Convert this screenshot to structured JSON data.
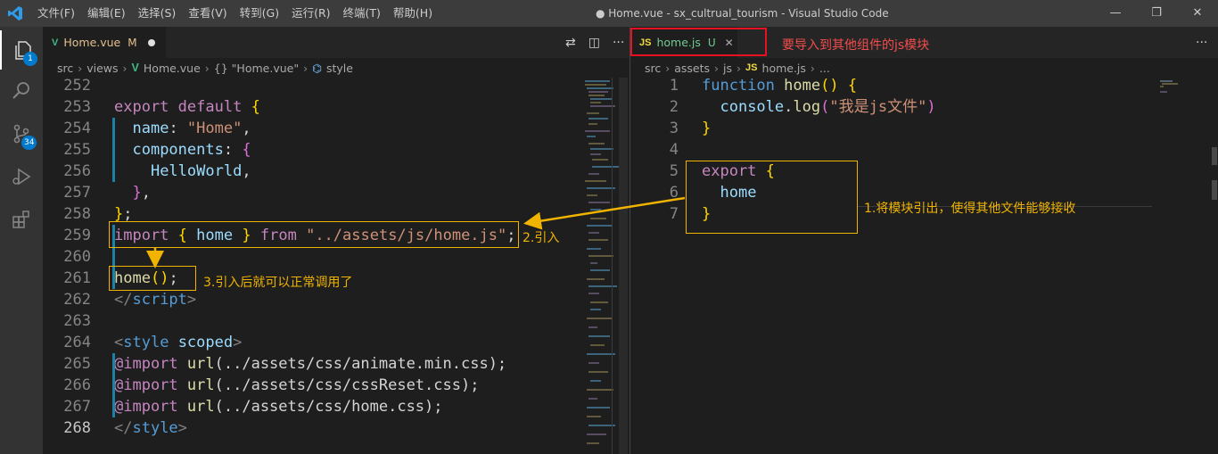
{
  "menu": [
    "文件(F)",
    "编辑(E)",
    "选择(S)",
    "查看(V)",
    "转到(G)",
    "运行(R)",
    "终端(T)",
    "帮助(H)"
  ],
  "window_title": "● Home.vue - sx_cultrual_tourism - Visual Studio Code",
  "window_controls": {
    "minimize": "—",
    "restore": "❐",
    "close": "✕"
  },
  "activity": {
    "explorer_badge": "1",
    "scm_badge": "34"
  },
  "left": {
    "tab": {
      "icon": "V",
      "name": "Home.vue",
      "status": "M"
    },
    "breadcrumbs": [
      "src",
      "views",
      "Home.vue",
      "{} \"Home.vue\"",
      "style"
    ],
    "lines": [
      {
        "n": "252",
        "tokens": []
      },
      {
        "n": "253",
        "tokens": [
          [
            "kw",
            "export"
          ],
          [
            "pc",
            " "
          ],
          [
            "kw",
            "default"
          ],
          [
            "pc",
            " "
          ],
          [
            "br1",
            "{"
          ]
        ]
      },
      {
        "n": "254",
        "tokens": [
          [
            "pc",
            "  "
          ],
          [
            "pr",
            "name"
          ],
          [
            "pc",
            ": "
          ],
          [
            "st",
            "\"Home\""
          ],
          [
            "pc",
            ","
          ]
        ]
      },
      {
        "n": "255",
        "tokens": [
          [
            "pc",
            "  "
          ],
          [
            "pr",
            "components"
          ],
          [
            "pc",
            ": "
          ],
          [
            "br2",
            "{"
          ]
        ]
      },
      {
        "n": "256",
        "tokens": [
          [
            "pc",
            "    "
          ],
          [
            "vr",
            "HelloWorld"
          ],
          [
            "pc",
            ","
          ]
        ]
      },
      {
        "n": "257",
        "tokens": [
          [
            "pc",
            "  "
          ],
          [
            "br2",
            "}"
          ],
          [
            "pc",
            ","
          ]
        ]
      },
      {
        "n": "258",
        "tokens": [
          [
            "br1",
            "}"
          ],
          [
            "pc",
            ";"
          ]
        ]
      },
      {
        "n": "259",
        "tokens": [
          [
            "kw",
            "import"
          ],
          [
            "pc",
            " "
          ],
          [
            "br1",
            "{"
          ],
          [
            "pc",
            " "
          ],
          [
            "vr",
            "home"
          ],
          [
            "pc",
            " "
          ],
          [
            "br1",
            "}"
          ],
          [
            "pc",
            " "
          ],
          [
            "kw",
            "from"
          ],
          [
            "pc",
            " "
          ],
          [
            "st",
            "\"../assets/js/home.js\""
          ],
          [
            "pc",
            ";"
          ]
        ]
      },
      {
        "n": "260",
        "tokens": []
      },
      {
        "n": "261",
        "tokens": [
          [
            "fn",
            "home"
          ],
          [
            "br1",
            "()"
          ],
          [
            "pc",
            ";"
          ]
        ]
      },
      {
        "n": "262",
        "tokens": [
          [
            "tag",
            "</"
          ],
          [
            "tg",
            "script"
          ],
          [
            "tag",
            ">"
          ]
        ]
      },
      {
        "n": "263",
        "tokens": []
      },
      {
        "n": "264",
        "tokens": [
          [
            "tag",
            "<"
          ],
          [
            "tg",
            "style"
          ],
          [
            "pc",
            " "
          ],
          [
            "at",
            "scoped"
          ],
          [
            "tag",
            ">"
          ]
        ]
      },
      {
        "n": "265",
        "tokens": [
          [
            "kw",
            "@import"
          ],
          [
            "pc",
            " "
          ],
          [
            "fn",
            "url"
          ],
          [
            "pc",
            "("
          ],
          [
            "ur",
            "../assets/css/animate.min.css"
          ],
          [
            "pc",
            ");"
          ]
        ]
      },
      {
        "n": "266",
        "tokens": [
          [
            "kw",
            "@import"
          ],
          [
            "pc",
            " "
          ],
          [
            "fn",
            "url"
          ],
          [
            "pc",
            "("
          ],
          [
            "ur",
            "../assets/css/cssReset.css"
          ],
          [
            "pc",
            ");"
          ]
        ]
      },
      {
        "n": "267",
        "tokens": [
          [
            "kw",
            "@import"
          ],
          [
            "pc",
            " "
          ],
          [
            "fn",
            "url"
          ],
          [
            "pc",
            "("
          ],
          [
            "ur",
            "../assets/css/home.css"
          ],
          [
            "pc",
            ");"
          ]
        ]
      },
      {
        "n": "268",
        "tokens": [
          [
            "tag",
            "</"
          ],
          [
            "tg",
            "style"
          ],
          [
            "tag",
            ">"
          ]
        ]
      }
    ],
    "current_line": "268",
    "annotation_import": "2.引入",
    "annotation_call": "3.引入后就可以正常调用了"
  },
  "right": {
    "tab": {
      "icon": "JS",
      "name": "home.js",
      "status": "U"
    },
    "tab_annotation": "要导入到其他组件的js模块",
    "breadcrumbs": [
      "src",
      "assets",
      "js",
      "JS",
      "home.js",
      "..."
    ],
    "lines": [
      {
        "n": "1",
        "tokens": [
          [
            "kb",
            "function"
          ],
          [
            "pc",
            " "
          ],
          [
            "fn",
            "home"
          ],
          [
            "br1",
            "()"
          ],
          [
            "pc",
            " "
          ],
          [
            "br1",
            "{"
          ]
        ]
      },
      {
        "n": "2",
        "tokens": [
          [
            "pc",
            "  "
          ],
          [
            "vr",
            "console"
          ],
          [
            "pc",
            "."
          ],
          [
            "fn",
            "log"
          ],
          [
            "br2",
            "("
          ],
          [
            "st",
            "\"我是js文件\""
          ],
          [
            "br2",
            ")"
          ]
        ]
      },
      {
        "n": "3",
        "tokens": [
          [
            "br1",
            "}"
          ]
        ]
      },
      {
        "n": "4",
        "tokens": []
      },
      {
        "n": "5",
        "tokens": [
          [
            "kw",
            "export"
          ],
          [
            "pc",
            " "
          ],
          [
            "br1",
            "{"
          ]
        ]
      },
      {
        "n": "6",
        "tokens": [
          [
            "pc",
            "  "
          ],
          [
            "vr",
            "home"
          ]
        ]
      },
      {
        "n": "7",
        "tokens": [
          [
            "br1",
            "}"
          ]
        ]
      }
    ],
    "annotation_export": "1.将模块引出，使得其他文件能够接收"
  },
  "icons": {
    "explorer": "files-icon",
    "search": "search-icon",
    "scm": "source-control-icon",
    "debug": "run-debug-icon",
    "extensions": "extensions-icon"
  },
  "colors": {
    "annotation": "#f0b400",
    "highlight_box": "#e81123",
    "accent": "#007acc"
  }
}
